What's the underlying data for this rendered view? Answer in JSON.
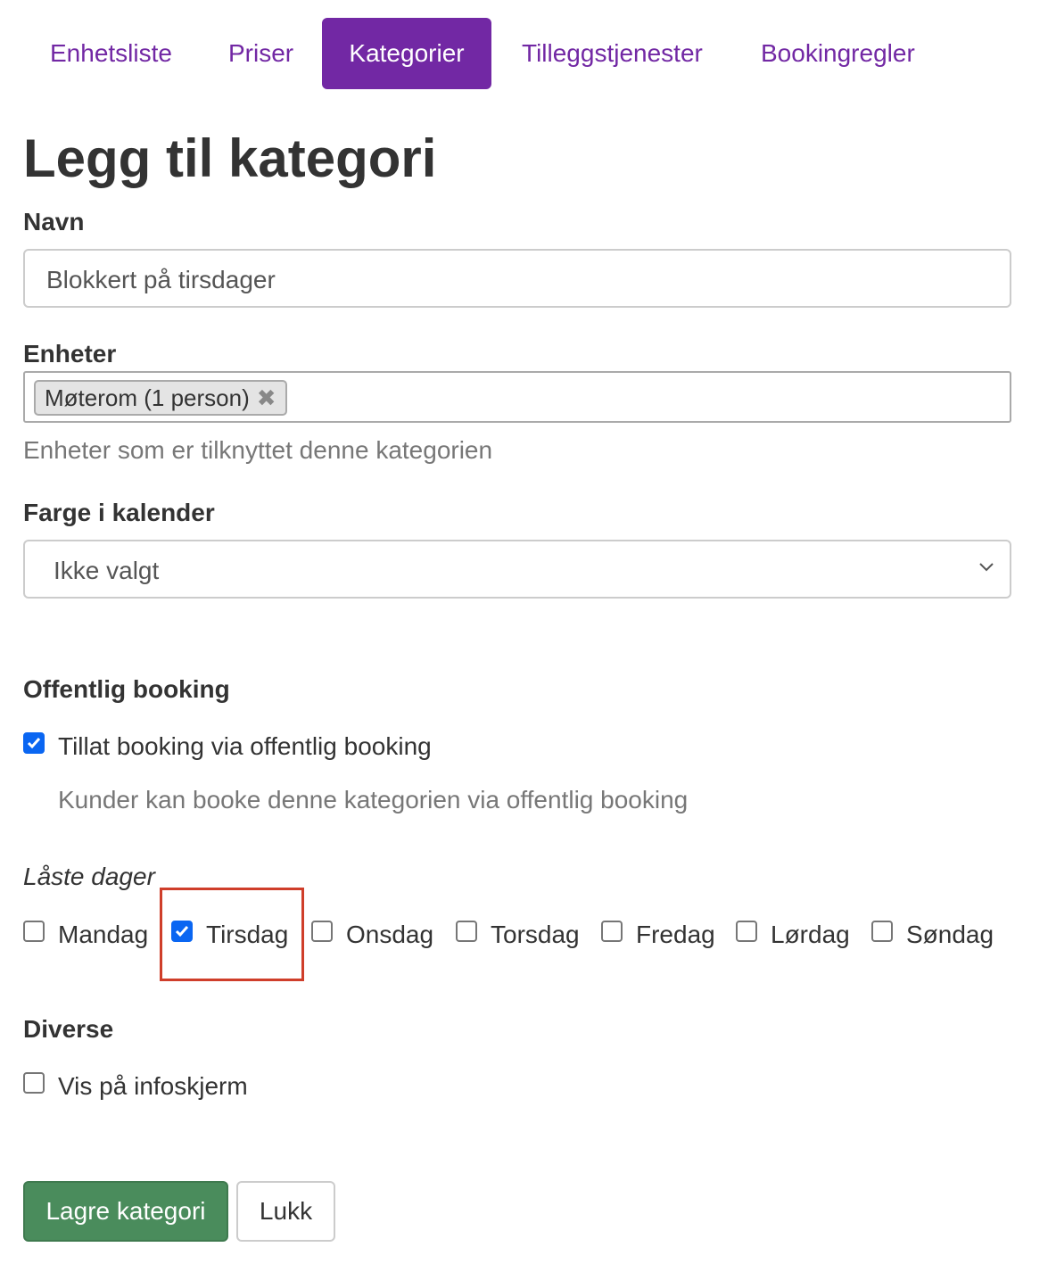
{
  "tabs": [
    {
      "label": "Enhetsliste",
      "active": false
    },
    {
      "label": "Priser",
      "active": false
    },
    {
      "label": "Kategorier",
      "active": true
    },
    {
      "label": "Tilleggstjenester",
      "active": false
    },
    {
      "label": "Bookingregler",
      "active": false
    }
  ],
  "page_title": "Legg til kategori",
  "name_field": {
    "label": "Navn",
    "value": "Blokkert på tirsdager"
  },
  "units_field": {
    "label": "Enheter",
    "selected": [
      {
        "label": "Møterom (1 person)",
        "remove_icon": "close-icon"
      }
    ],
    "help": "Enheter som er tilknyttet denne kategorien"
  },
  "color_field": {
    "label": "Farge i kalender",
    "value": "Ikke valgt",
    "icon": "chevron-down-icon"
  },
  "public_booking": {
    "heading": "Offentlig booking",
    "checkbox_label": "Tillat booking via offentlig booking",
    "checked": true,
    "help": "Kunder kan booke denne kategorien via offentlig booking"
  },
  "locked_days": {
    "label": "Låste dager",
    "days": [
      {
        "label": "Mandag",
        "checked": false
      },
      {
        "label": "Tirsdag",
        "checked": true
      },
      {
        "label": "Onsdag",
        "checked": false
      },
      {
        "label": "Torsdag",
        "checked": false
      },
      {
        "label": "Fredag",
        "checked": false
      },
      {
        "label": "Lørdag",
        "checked": false
      },
      {
        "label": "Søndag",
        "checked": false
      }
    ]
  },
  "misc": {
    "heading": "Diverse",
    "infoscreen_label": "Vis på infoskjerm",
    "infoscreen_checked": false
  },
  "actions": {
    "save_label": "Lagre kategori",
    "close_label": "Lukk"
  },
  "colors": {
    "accent": "#7228a4",
    "save_button": "#4a8c5c",
    "checkbox_checked": "#0a66f2",
    "highlight": "#cf3e2a"
  }
}
